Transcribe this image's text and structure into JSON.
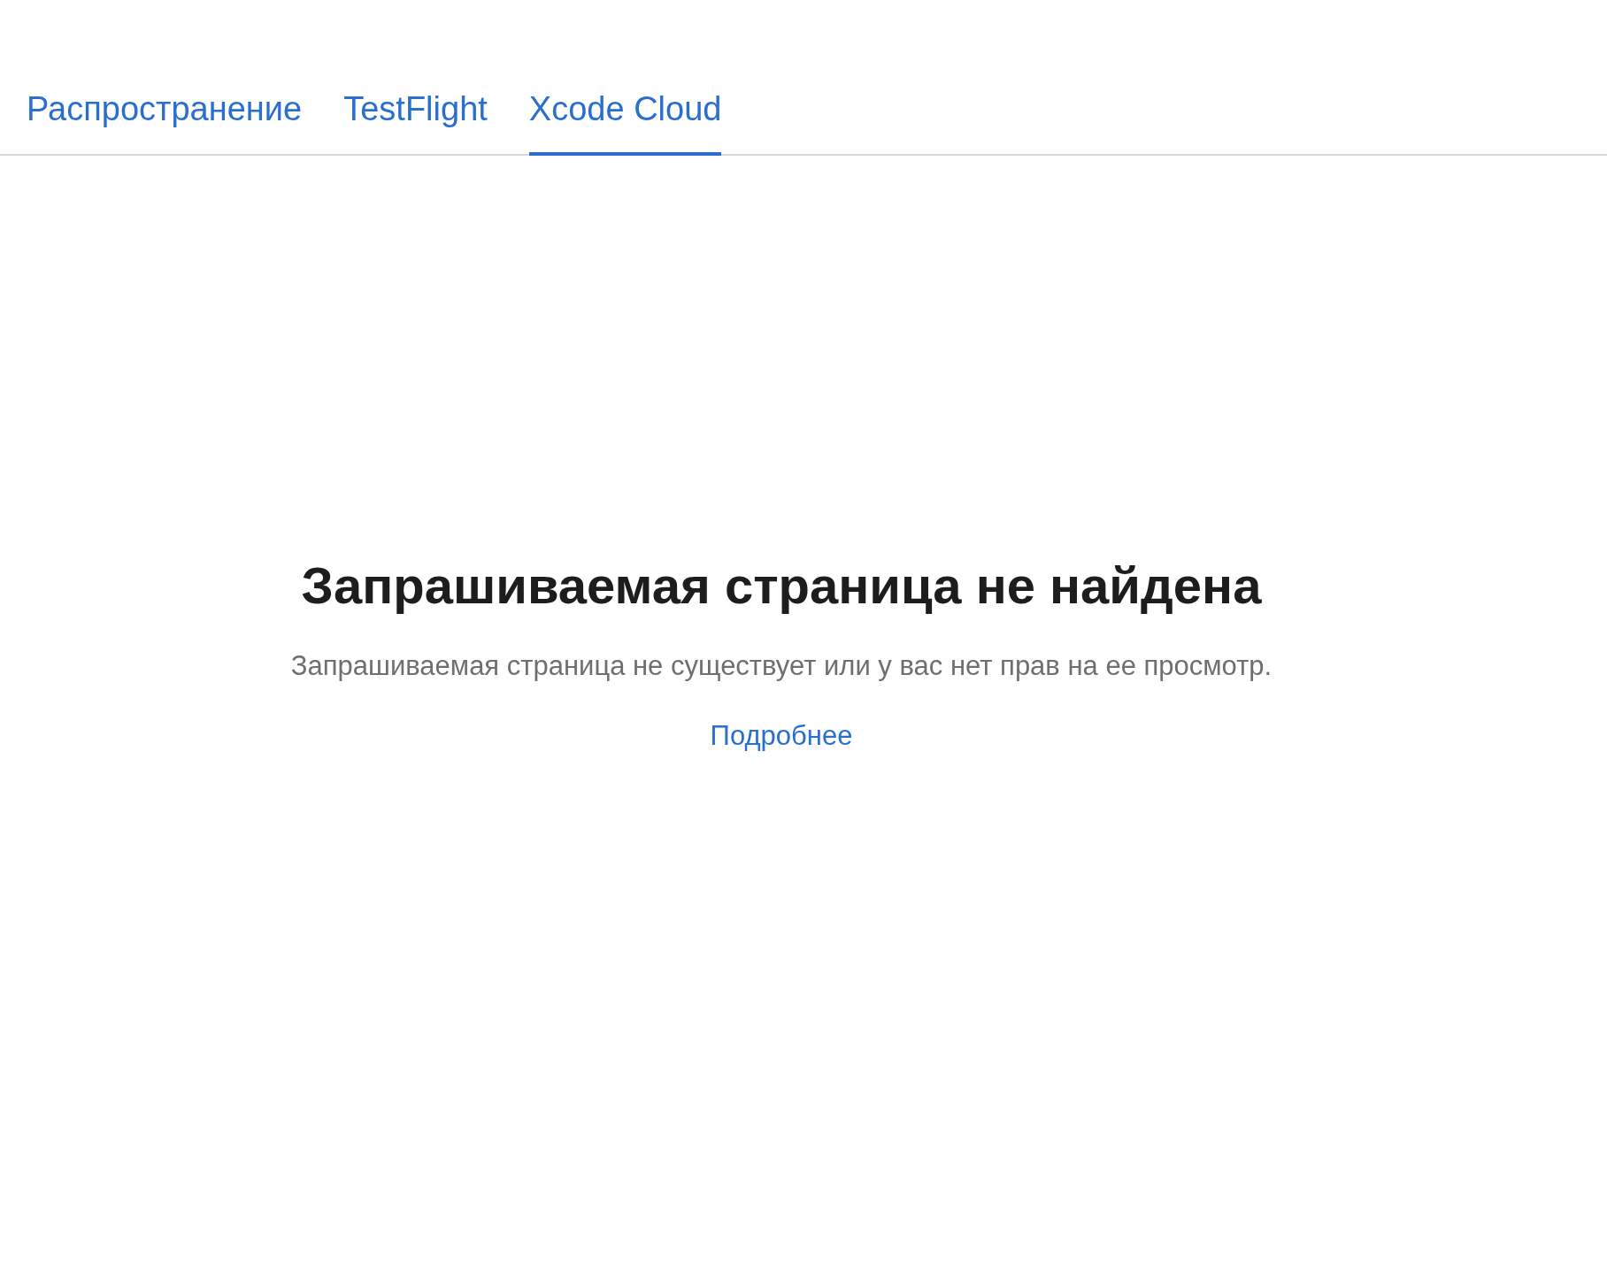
{
  "tabs": [
    {
      "label": "Распространение",
      "selected": false
    },
    {
      "label": "TestFlight",
      "selected": false
    },
    {
      "label": "Xcode Cloud",
      "selected": true
    }
  ],
  "message": {
    "title": "Запрашиваемая страница не найдена",
    "description": "Запрашиваемая страница не существует или у вас нет прав на ее просмотр.",
    "link": "Подробнее"
  }
}
